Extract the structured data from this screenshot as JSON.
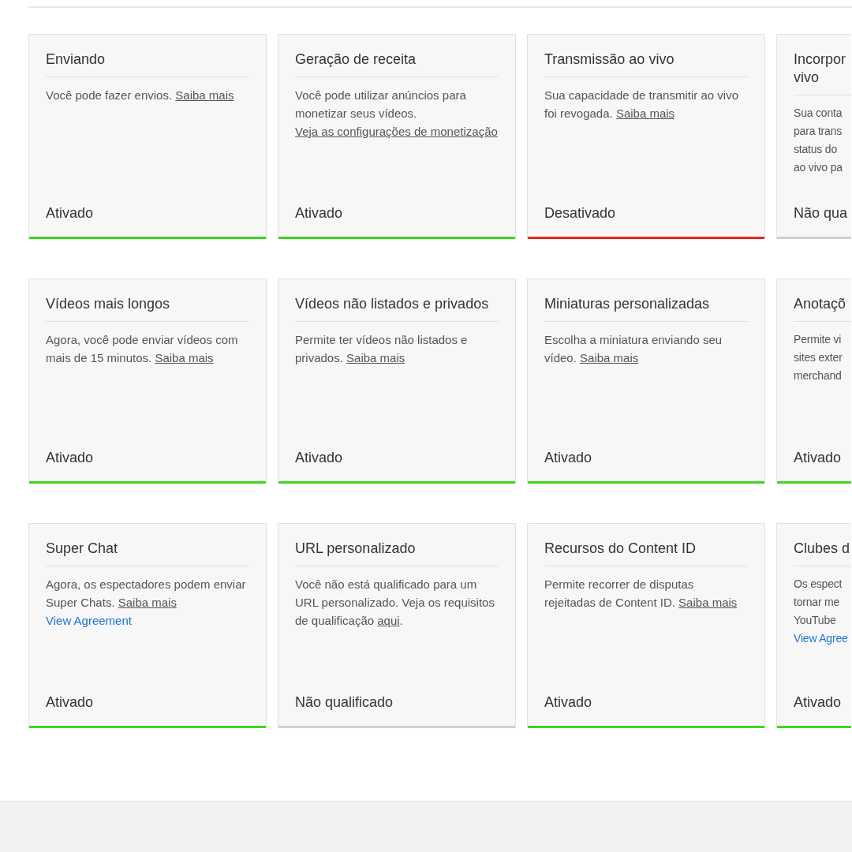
{
  "rows": [
    {
      "cards": [
        {
          "kind": "full",
          "title": "Enviando",
          "description": "Você pode fazer envios.",
          "link": "Saiba mais",
          "status": "Ativado",
          "color": "#3fd51f"
        },
        {
          "kind": "full",
          "title": "Geração de receita",
          "description": "Você pode utilizar anúncios para monetizar seus vídeos.",
          "link": "Veja as configurações de monetização",
          "status": "Ativado",
          "color": "#3fd51f"
        },
        {
          "kind": "full",
          "title": "Transmissão ao vivo",
          "description": "Sua capacidade de transmitir ao vivo foi revogada.",
          "link": "Saiba mais",
          "status": "Desativado",
          "color": "#e42a1e"
        },
        {
          "kind": "cut",
          "title_lines": [
            "Incorpor",
            "vivo"
          ],
          "lines": [
            {
              "text": "Sua conta",
              "link": false
            },
            {
              "text": "para trans",
              "link": false
            },
            {
              "text": "status do",
              "link": false
            },
            {
              "text": "ao vivo pa",
              "link": false
            }
          ],
          "status": "Não qua",
          "color": "#d0d0d0"
        }
      ]
    },
    {
      "cards": [
        {
          "kind": "full",
          "title": "Vídeos mais longos",
          "description": "Agora, você pode enviar vídeos com mais de 15 minutos.",
          "link": "Saiba mais",
          "status": "Ativado",
          "color": "#3fd51f"
        },
        {
          "kind": "full",
          "title": "Vídeos não listados e privados",
          "description": "Permite ter vídeos não listados e privados.",
          "link": "Saiba mais",
          "status": "Ativado",
          "color": "#3fd51f"
        },
        {
          "kind": "full",
          "title": "Miniaturas personalizadas",
          "description": "Escolha a miniatura enviando seu vídeo.",
          "link": "Saiba mais",
          "status": "Ativado",
          "color": "#3fd51f"
        },
        {
          "kind": "cut",
          "title_lines": [
            "Anotaçõ"
          ],
          "lines": [
            {
              "text": "Permite vi",
              "link": false
            },
            {
              "text": "sites exter",
              "link": false
            },
            {
              "text": "merchand",
              "link": false
            }
          ],
          "status": "Ativado",
          "color": "#3fd51f"
        }
      ]
    },
    {
      "cards": [
        {
          "kind": "full",
          "title": "Super Chat",
          "description": "Agora, os espectadores podem enviar Super Chats.",
          "link": "Saiba mais",
          "agreement": "View Agreement",
          "status": "Ativado",
          "color": "#3fd51f"
        },
        {
          "kind": "full",
          "title": "URL personalizado",
          "description": "Você não está qualificado para um URL personalizado. Veja os requisitos de qualificação",
          "link": "aqui",
          "suffix": ".",
          "status": "Não qualificado",
          "color": "#d0d0d0"
        },
        {
          "kind": "full",
          "title": "Recursos do Content ID",
          "description": "Permite recorrer de disputas rejeitadas de Content ID.",
          "link": "Saiba mais",
          "status": "Ativado",
          "color": "#3fd51f"
        },
        {
          "kind": "cut",
          "title_lines": [
            "Clubes d"
          ],
          "lines": [
            {
              "text": "Os espect",
              "link": false
            },
            {
              "text": "tornar me",
              "link": false
            },
            {
              "text": "YouTube",
              "link": false
            },
            {
              "text": "View Agree",
              "link": true
            }
          ],
          "status": "Ativado",
          "color": "#3fd51f"
        }
      ]
    }
  ]
}
